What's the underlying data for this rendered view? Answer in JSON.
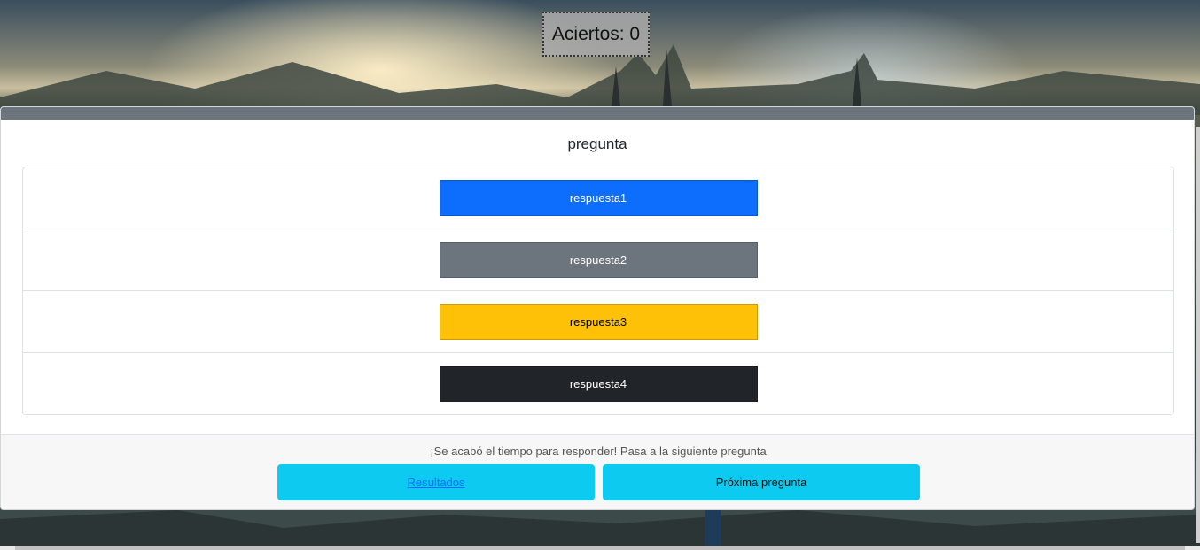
{
  "score": {
    "label": "Aciertos: 0"
  },
  "quiz": {
    "question": "pregunta",
    "answers": [
      {
        "label": "respuesta1",
        "bg": "#0d6efd",
        "fg": "#ffffff"
      },
      {
        "label": "respuesta2",
        "bg": "#6c757d",
        "fg": "#ffffff"
      },
      {
        "label": "respuesta3",
        "bg": "#ffc107",
        "fg": "#000000"
      },
      {
        "label": "respuesta4",
        "bg": "#212529",
        "fg": "#ffffff"
      }
    ],
    "header_color": "#6c757d"
  },
  "footer": {
    "timeout_message": "¡Se acabó el tiempo para responder! Pasa a la siguiente pregunta",
    "results_label": "Resultados",
    "next_label": "Próxima pregunta",
    "button_color": "#0dcaf0"
  }
}
